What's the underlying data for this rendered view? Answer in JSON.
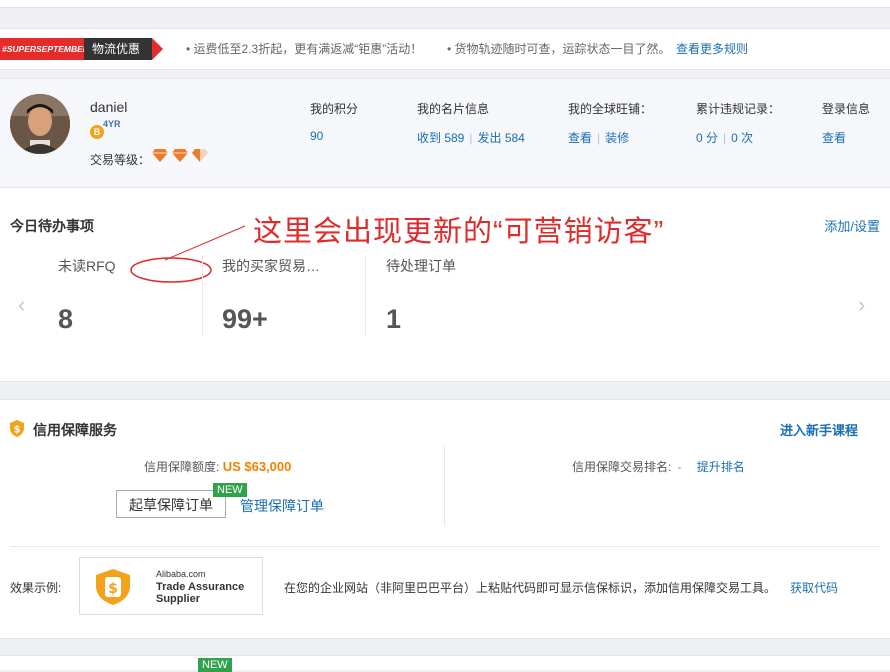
{
  "banner": {
    "tag": "#SUPERSEPTEMBER",
    "label": "物流优惠",
    "text1": "• 运费低至2.3折起，更有满返减“钜惠”活动！",
    "text2": "• 货物轨迹随时可查，运踪状态一目了然。",
    "link": "查看更多规则"
  },
  "profile": {
    "username": "daniel",
    "years": "4YR",
    "level_label": "交易等级：",
    "stats": [
      {
        "label": "我的积分",
        "value": "90"
      },
      {
        "label": "我的名片信息",
        "received": "收到 589",
        "sent": "发出 584"
      },
      {
        "label": "我的全球旺铺：",
        "view": "查看",
        "decorate": "装修"
      },
      {
        "label": "累计违规记录：",
        "points": "0 分",
        "times": "0 次"
      },
      {
        "label": "登录信息",
        "view": "查看"
      }
    ]
  },
  "todo": {
    "title": "今日待办事项",
    "add_link": "添加/设置",
    "annotation": "这里会出现更新的“可营销访客”",
    "items": [
      {
        "label": "未读RFQ",
        "count": "8"
      },
      {
        "label": "我的买家贸易…",
        "count": "99+"
      },
      {
        "label": "待处理订单",
        "count": "1"
      }
    ],
    "prev_icon": "‹",
    "next_icon": "›"
  },
  "credit": {
    "title": "信用保障服务",
    "course_link": "进入新手课程",
    "limit_label": "信用保障额度:",
    "limit_value": "US $63,000",
    "rank_label": "信用保障交易排名:",
    "rank_value": "-",
    "rank_link": "提升排名",
    "draft_button": "起草保障订单",
    "new_badge": "NEW",
    "manage_link": "管理保障订单",
    "effect_label": "效果示例:",
    "logo_line1": "Alibaba.com",
    "logo_line2": "Trade Assurance",
    "logo_line3": "Supplier",
    "logo_glyph": "$",
    "description": "在您的企业网站（非阿里巴巴平台）上粘贴代码即可显示信保标识，添加信用保障交易工具。",
    "get_code": "获取代码"
  },
  "bottom": {
    "new_badge": "NEW"
  },
  "colors": {
    "link": "#1b6fb5",
    "accent_red": "#e62b2b",
    "orange": "#f08200",
    "new_green": "#2fa24a"
  }
}
